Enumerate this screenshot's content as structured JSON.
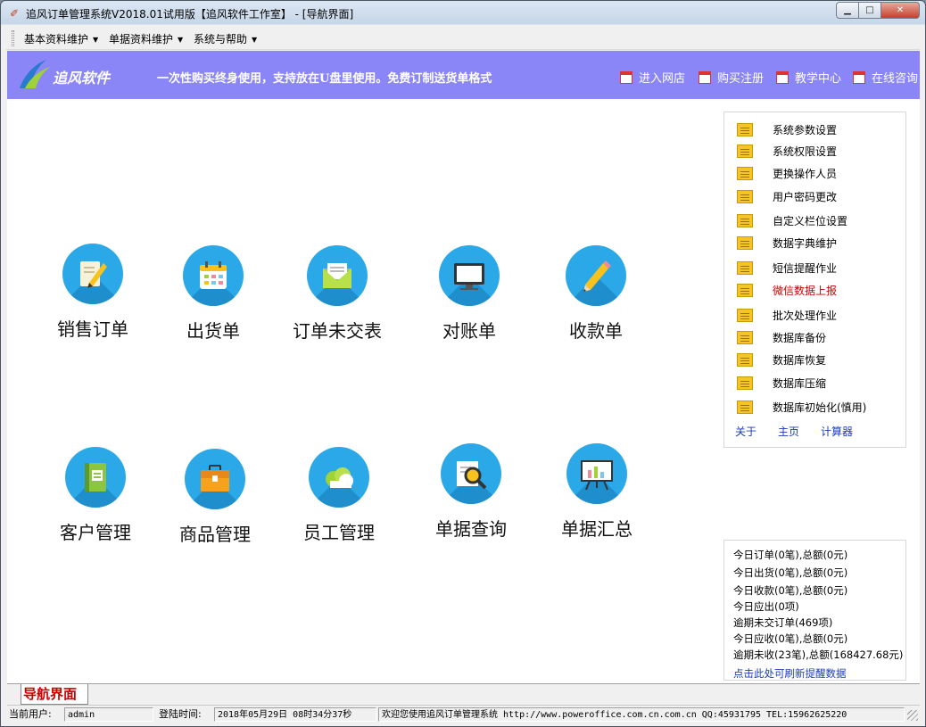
{
  "window": {
    "title": "追风订单管理系统V2018.01试用版【追风软件工作室】 - [导航界面]"
  },
  "menu": [
    {
      "label": "基本资料维护"
    },
    {
      "label": "单据资料维护"
    },
    {
      "label": "系统与帮助"
    }
  ],
  "banner": {
    "logo_text": "追风软件",
    "slogan": "一次性购买终身使用，支持放在U盘里使用。免费订制送货单格式",
    "links": [
      {
        "label": "进入网店"
      },
      {
        "label": "购买注册"
      },
      {
        "label": "教学中心"
      },
      {
        "label": "在线咨询"
      }
    ]
  },
  "tiles": [
    {
      "label": "销售订单",
      "icon": "pencil-paper-icon"
    },
    {
      "label": "出货单",
      "icon": "calendar-icon"
    },
    {
      "label": "订单未交表",
      "icon": "envelope-icon"
    },
    {
      "label": "对账单",
      "icon": "monitor-icon"
    },
    {
      "label": "收款单",
      "icon": "pencil-icon"
    },
    {
      "label": "客户管理",
      "icon": "book-icon"
    },
    {
      "label": "商品管理",
      "icon": "briefcase-icon"
    },
    {
      "label": "员工管理",
      "icon": "cloud-icon"
    },
    {
      "label": "单据查询",
      "icon": "magnifier-icon"
    },
    {
      "label": "单据汇总",
      "icon": "presentation-icon"
    }
  ],
  "side_menu": [
    {
      "label": "系统参数设置"
    },
    {
      "label": "系统权限设置"
    },
    {
      "label": "更换操作人员"
    },
    {
      "label": "用户密码更改"
    },
    {
      "label": "自定义栏位设置"
    },
    {
      "label": "数据字典维护"
    },
    {
      "label": "短信提醒作业"
    },
    {
      "label": "微信数据上报",
      "highlight": "#cc0000"
    },
    {
      "label": "批次处理作业"
    },
    {
      "label": "数据库备份"
    },
    {
      "label": "数据库恢复"
    },
    {
      "label": "数据库压缩"
    },
    {
      "label": "数据库初始化(慎用)"
    }
  ],
  "side_links": {
    "about": "关于",
    "home": "主页",
    "calculator": "计算器"
  },
  "stats": [
    "今日订单(0笔),总额(0元)",
    "今日出货(0笔),总额(0元)",
    "今日收款(0笔),总额(0元)",
    "今日应出(0项)",
    "逾期未交订单(469项)",
    "今日应收(0笔),总额(0元)",
    "逾期未收(23笔),总额(168427.68元)"
  ],
  "stats_refresh": "点击此处可刷新提醒数据",
  "tab": {
    "label": "导航界面"
  },
  "status": {
    "user_label": "当前用户:",
    "user_value": "admin",
    "login_label": "登陆时间:",
    "login_value": "2018年05月29日 08时34分37秒",
    "welcome": "欢迎您使用追风订单管理系统 http://www.poweroffice.com.cn.com.cn QQ:45931795 TEL:15962625220"
  },
  "colors": {
    "banner": "#8b86f8",
    "tile_circle": "#2aa8e8",
    "highlight": "#cc0000",
    "link": "#1a3cb8"
  }
}
